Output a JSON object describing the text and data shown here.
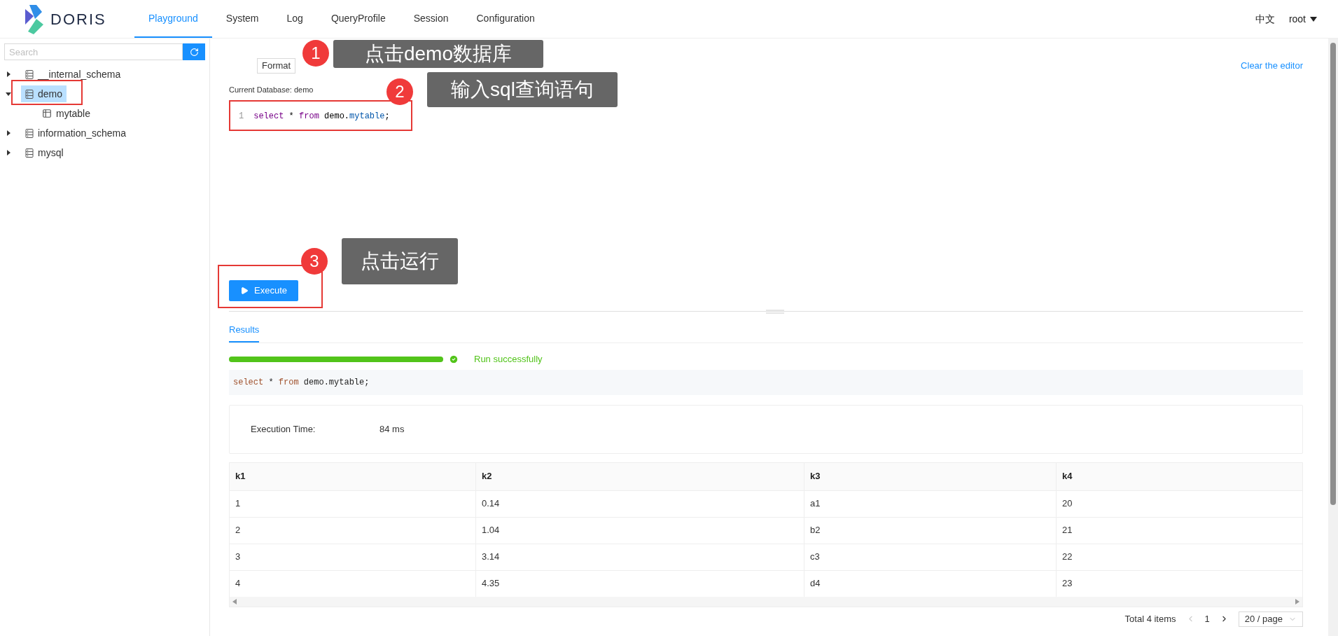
{
  "header": {
    "logo_text": "DORIS",
    "tabs": [
      {
        "label": "Playground",
        "selected": true
      },
      {
        "label": "System",
        "selected": false
      },
      {
        "label": "Log",
        "selected": false
      },
      {
        "label": "QueryProfile",
        "selected": false
      },
      {
        "label": "Session",
        "selected": false
      },
      {
        "label": "Configuration",
        "selected": false
      }
    ],
    "language": "中文",
    "user": "root"
  },
  "sidebar": {
    "search": {
      "placeholder": "Search"
    },
    "tree": [
      {
        "label": "__internal_schema",
        "kind": "database",
        "expanded": false,
        "selected": false
      },
      {
        "label": "demo",
        "kind": "database",
        "expanded": true,
        "selected": true,
        "children": [
          {
            "label": "mytable",
            "kind": "table",
            "selected": false
          }
        ]
      },
      {
        "label": "information_schema",
        "kind": "database",
        "expanded": false,
        "selected": false
      },
      {
        "label": "mysql",
        "kind": "database",
        "expanded": false,
        "selected": false
      }
    ]
  },
  "editor": {
    "format_button": "Format",
    "clear_link": "Clear the editor",
    "current_database": "Current Database: demo",
    "lines": [
      {
        "number": "1",
        "tokens": [
          {
            "text": "select",
            "kind": "keyword"
          },
          {
            "text": " * ",
            "kind": "plain"
          },
          {
            "text": "from",
            "kind": "keyword"
          },
          {
            "text": " demo.",
            "kind": "plain"
          },
          {
            "text": "mytable",
            "kind": "property"
          },
          {
            "text": ";",
            "kind": "plain"
          }
        ]
      }
    ],
    "execute_button": "Execute"
  },
  "results": {
    "tabs": [
      {
        "label": "Results",
        "selected": true
      }
    ],
    "progress": {
      "level": 1,
      "status": "Run successfully"
    },
    "sql_tokens": [
      {
        "text": "select",
        "kind": "keyword"
      },
      {
        "text": " * ",
        "kind": "plain"
      },
      {
        "text": "from",
        "kind": "keyword"
      },
      {
        "text": " demo.mytable;",
        "kind": "plain"
      }
    ],
    "execution_time": {
      "label": "Execution Time:",
      "value": "84 ms"
    },
    "table": {
      "columns": [
        "k1",
        "k2",
        "k3",
        "k4"
      ],
      "rows": [
        [
          "1",
          "0.14",
          "a1",
          "20"
        ],
        [
          "2",
          "1.04",
          "b2",
          "21"
        ],
        [
          "3",
          "3.14",
          "c3",
          "22"
        ],
        [
          "4",
          "4.35",
          "d4",
          "23"
        ]
      ]
    },
    "pagination": {
      "total": "Total 4 items",
      "current_page": "1",
      "page_size": "20 / page"
    }
  },
  "annotations": [
    {
      "number": "1",
      "text": "点击demo数据库"
    },
    {
      "number": "2",
      "text": "输入sql查询语句"
    },
    {
      "number": "3",
      "text": "点击运行"
    }
  ]
}
